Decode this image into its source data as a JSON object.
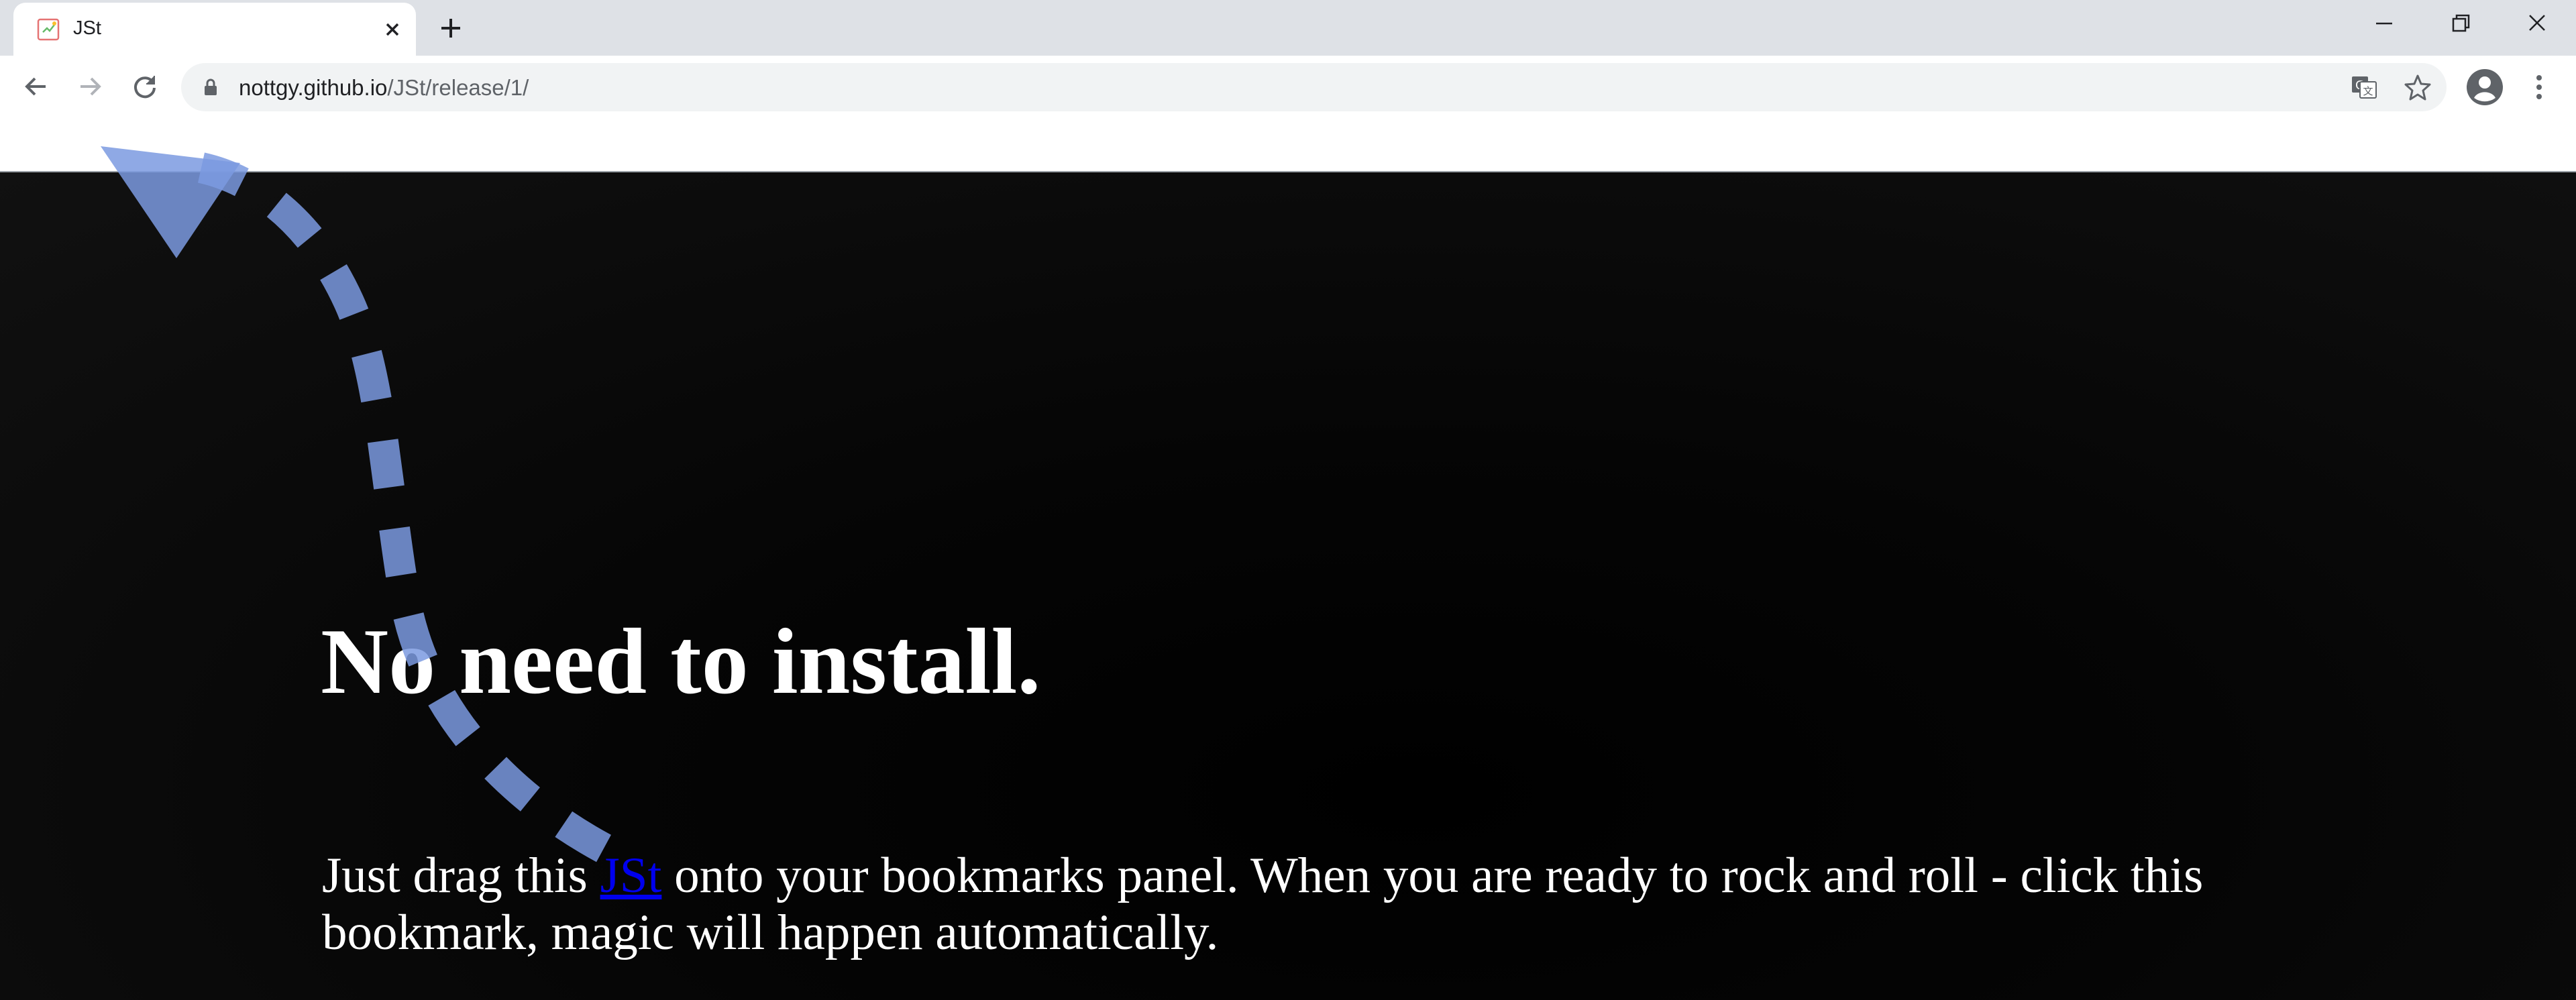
{
  "browser": {
    "tab": {
      "title": "JSt",
      "favicon": "page-favicon-icon"
    },
    "new_tab_icon": "plus-icon",
    "window_controls": [
      "minimize-icon",
      "restore-icon",
      "close-icon"
    ],
    "toolbar": {
      "back_icon": "arrow-left-icon",
      "forward_icon": "arrow-right-icon",
      "reload_icon": "reload-icon",
      "address": {
        "host": "nottgy.github.io",
        "path": "/JSt/release/1/",
        "lock_icon": "lock-icon"
      },
      "translate_icon": "translate-icon",
      "bookmark_icon": "star-icon",
      "profile_icon": "account-circle-icon",
      "menu_icon": "kebab-menu-icon"
    }
  },
  "page": {
    "headline": "No need to install.",
    "body": {
      "before": "Just drag this ",
      "link": "JSt",
      "after": " onto your bookmarks panel. When you are ready to rock and roll - click this bookmark, magic will happen automatically."
    },
    "arrow_color": "#7b9ae0"
  }
}
